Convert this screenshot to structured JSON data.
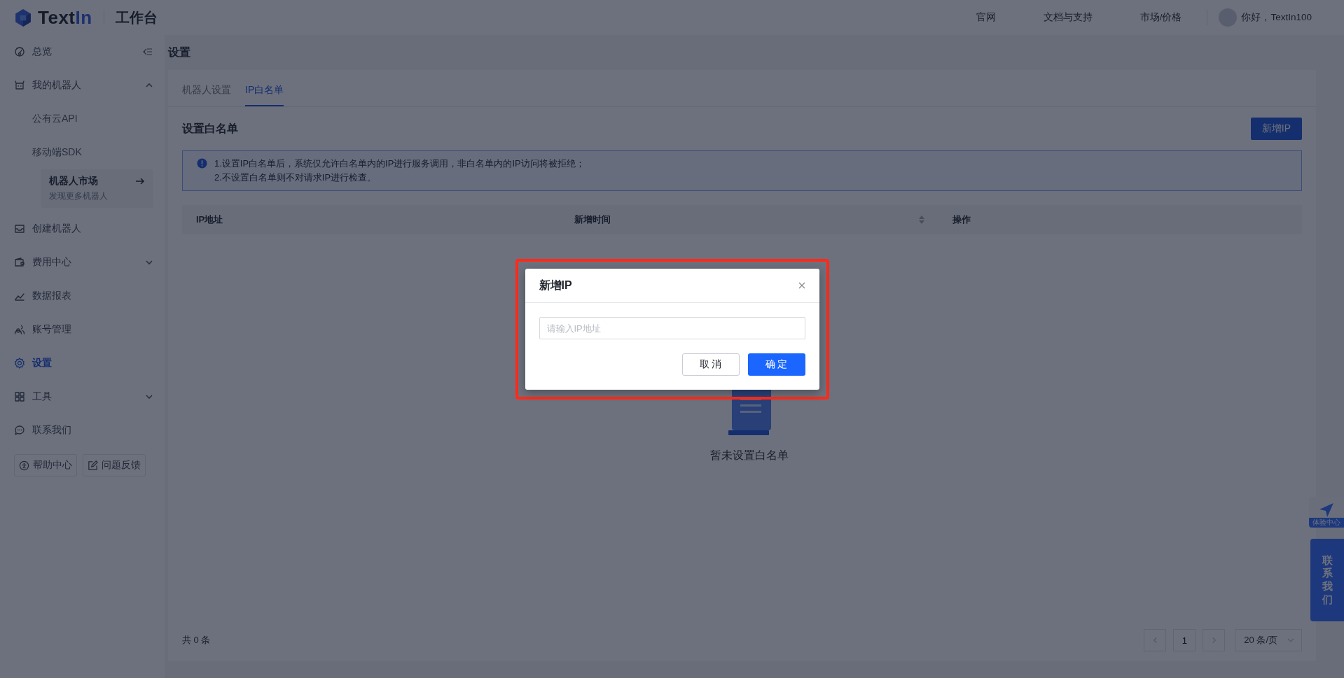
{
  "header": {
    "brand": {
      "name": "Text",
      "accent": "In"
    },
    "product": "工作台",
    "nav": [
      "官网",
      "文档与支持",
      "市场/价格"
    ],
    "greeting": "你好，TextIn100"
  },
  "sidebar": {
    "items": [
      {
        "label": "总览",
        "selected": false
      },
      {
        "label": "我的机器人",
        "selected": false,
        "expanded": true,
        "children": [
          {
            "kind": "link",
            "label": "公有云API",
            "selected": false
          },
          {
            "kind": "link",
            "label": "移动端SDK",
            "selected": false
          },
          {
            "kind": "card",
            "title": "机器人市场",
            "subtitle": "发现更多机器人"
          }
        ]
      },
      {
        "label": "创建机器人",
        "selected": false
      },
      {
        "label": "费用中心",
        "selected": false,
        "expanded": false
      },
      {
        "label": "数据报表",
        "selected": false
      },
      {
        "label": "账号管理",
        "selected": false
      },
      {
        "label": "设置",
        "selected": true
      },
      {
        "label": "工具",
        "selected": false,
        "expanded": false
      },
      {
        "label": "联系我们",
        "selected": false
      }
    ],
    "buttons": [
      "帮助中心",
      "问题反馈"
    ]
  },
  "page_title": "设置",
  "tabs": [
    {
      "label": "机器人设置",
      "selected": false
    },
    {
      "label": "IP白名单",
      "selected": true
    }
  ],
  "section_title": "设置白名单",
  "add_button": "新增IP",
  "notice": [
    "1.设置IP白名单后，系统仅允许白名单内的IP进行服务调用，非白名单内的IP访问将被拒绝；",
    "2.不设置白名单则不对请求IP进行检查。"
  ],
  "table": {
    "columns": [
      {
        "label": "IP地址",
        "sortable": false
      },
      {
        "label": "新增时间",
        "sortable": true
      },
      {
        "label": "操作",
        "sortable": false
      }
    ],
    "empty_text": "暂未设置白名单"
  },
  "footer": {
    "total": "共 0 条",
    "page": "1",
    "page_size": "20 条/页"
  },
  "float": {
    "experience": "体验中心",
    "contact": "联系我们"
  },
  "dialog": {
    "title": "新增IP",
    "input": {
      "placeholder": "请输入IP地址"
    },
    "cancel": "取 消",
    "confirm": "确 定"
  }
}
